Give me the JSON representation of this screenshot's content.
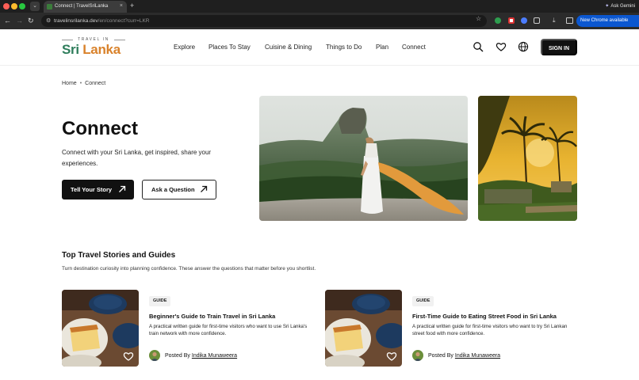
{
  "browser": {
    "tab_title": "Connect | TravelSriLanka",
    "new_tab": "+",
    "tab_close": "×",
    "gemini_label": "Ask Gemini",
    "url_host": "travelinsrilanka.dev",
    "url_path": "/en/connect?curr=LKR",
    "update_label": "New Chrome available"
  },
  "site": {
    "logo_top": "TRAVEL IN",
    "logo_sri": "Sri",
    "logo_lanka": "Lanka",
    "nav": [
      "Explore",
      "Places To Stay",
      "Cuisine & Dining",
      "Things to Do",
      "Plan",
      "Connect"
    ],
    "sign_in": "SIGN IN"
  },
  "breadcrumb": {
    "home": "Home",
    "sep": "•",
    "current": "Connect"
  },
  "hero": {
    "title": "Connect",
    "subtitle": "Connect with your Sri Lanka, get inspired, share your experiences.",
    "primary_button": "Tell Your Story",
    "secondary_button": "Ask a Question"
  },
  "stories": {
    "title": "Top Travel Stories and Guides",
    "subtitle": "Turn destination curiosity into planning confidence. These answer the questions that matter before you shortlist.",
    "cards": [
      {
        "badge": "GUIDE",
        "title": "Beginner's Guide to Train Travel in Sri Lanka",
        "description": "A practical written guide for first-time visitors who want to use Sri Lanka's train network with more confidence.",
        "posted_by": "Posted By",
        "author": "Indika Munaweera"
      },
      {
        "badge": "GUIDE",
        "title": "First-Time Guide to Eating Street Food in Sri Lanka",
        "description": "A practical written guide for first-time visitors who want to try Sri Lankan street food with more confidence.",
        "posted_by": "Posted By",
        "author": "Indika Munaweera"
      }
    ]
  },
  "colors": {
    "brand_green": "#2e7d5b",
    "brand_orange": "#d9822b",
    "button_dark": "#111111",
    "chrome_update_blue": "#0b57d0"
  }
}
